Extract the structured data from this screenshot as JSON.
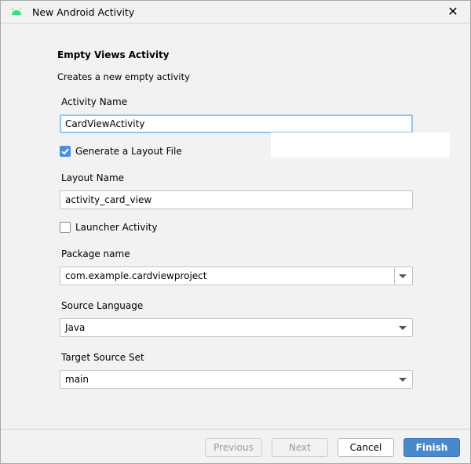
{
  "window": {
    "title": "New Android Activity",
    "close_icon": "close-icon",
    "app_icon": "android-icon"
  },
  "heading": "Empty Views Activity",
  "description": "Creates a new empty activity",
  "activity_name": {
    "label": "Activity Name",
    "value": "CardViewActivity"
  },
  "generate_layout": {
    "label": "Generate a Layout File",
    "checked": true
  },
  "layout_name": {
    "label": "Layout Name",
    "value": "activity_card_view"
  },
  "launcher_activity": {
    "label": "Launcher Activity",
    "checked": false
  },
  "package_name": {
    "label": "Package name",
    "value": "com.example.cardviewproject"
  },
  "source_language": {
    "label": "Source Language",
    "value": "Java"
  },
  "target_source_set": {
    "label": "Target Source Set",
    "value": "main"
  },
  "buttons": {
    "previous": "Previous",
    "next": "Next",
    "cancel": "Cancel",
    "finish": "Finish"
  },
  "colors": {
    "accent": "#4a88cc",
    "android": "#3ddc84"
  }
}
